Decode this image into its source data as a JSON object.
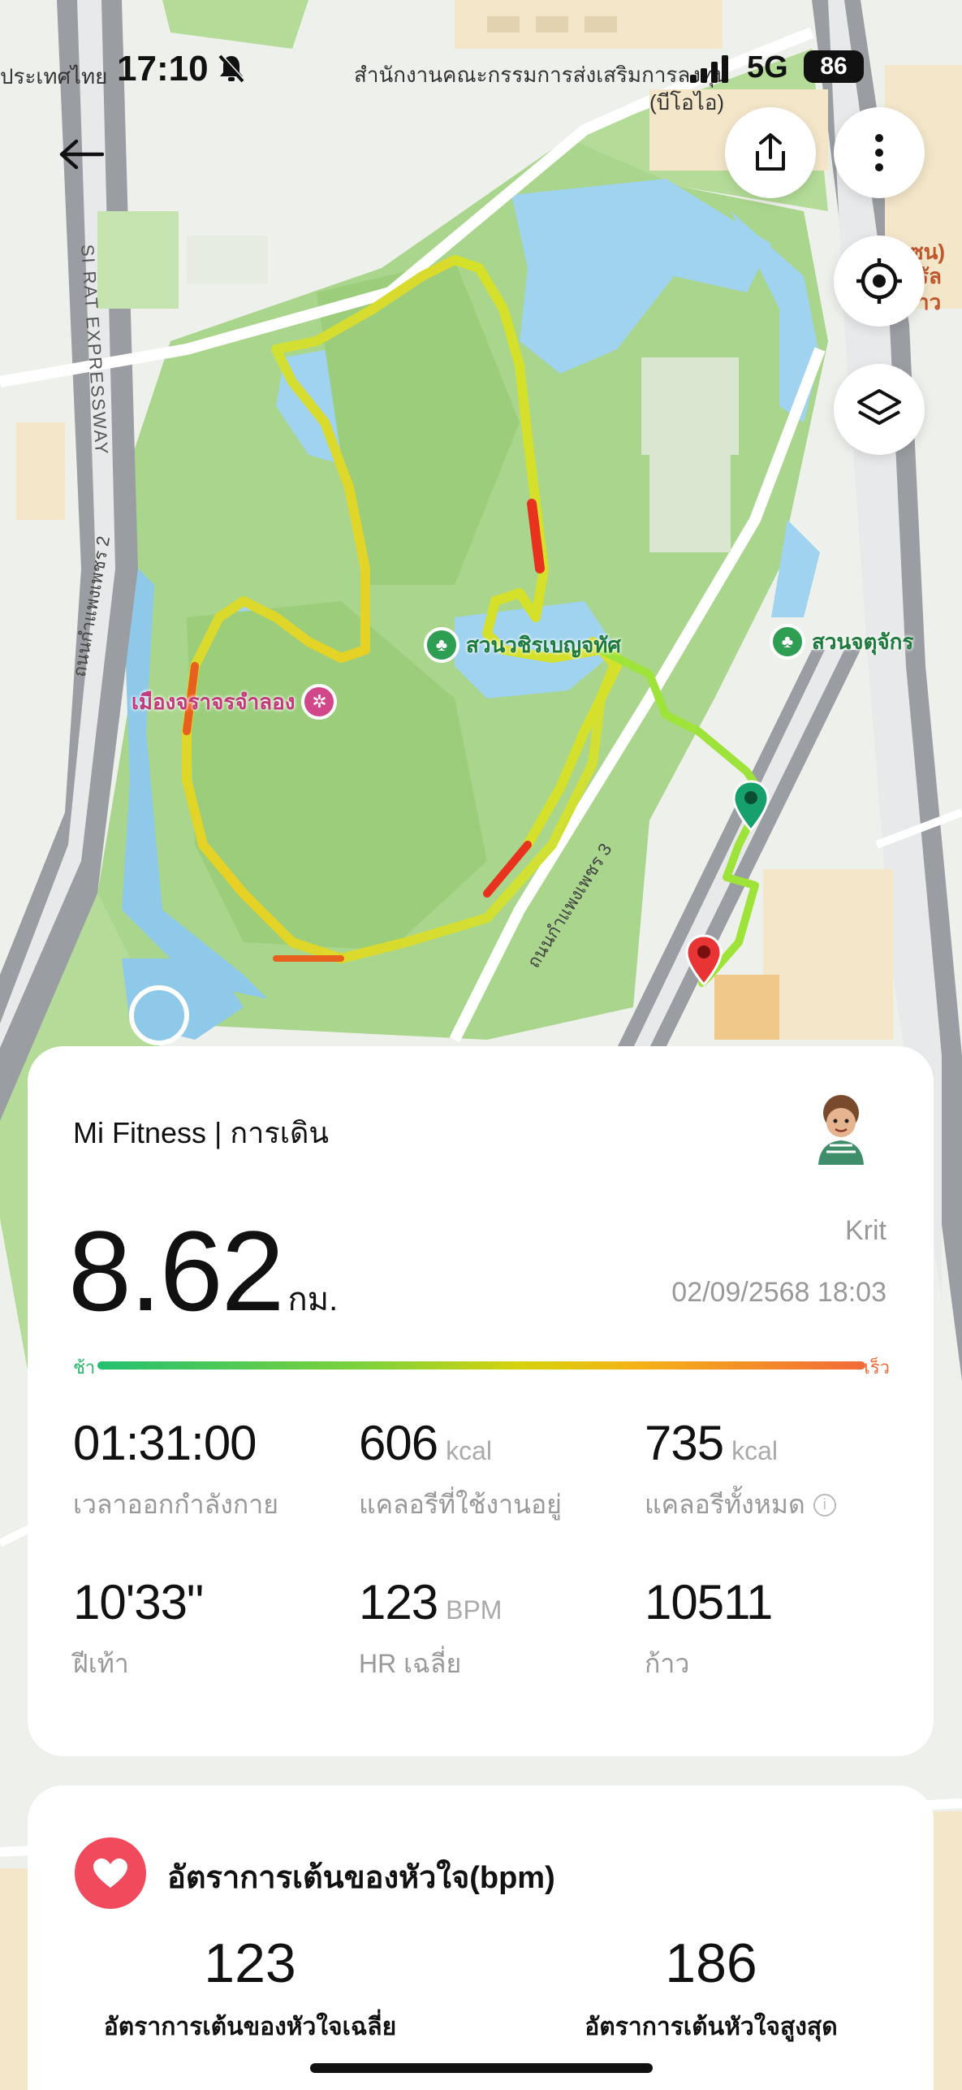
{
  "status_bar": {
    "time": "17:10",
    "network": "5G",
    "battery": "86",
    "map_label_left": "ประเทศไทย",
    "map_label_center": "สำนักงานคณะกรรมการส่งเสริมการลงทุน",
    "map_label_center_sub": "(บีโอไอ)"
  },
  "map": {
    "expressway_label": "SI RAT EXPRESSWAY",
    "road_label_1": "ถนนกำแพงเพชร 2",
    "road_label_2": "ถนนกำแพงเพชร 3",
    "poi_1": "สวนวชิรเบญจทัศ",
    "poi_2": "สวนจตุจักร",
    "poi_3": "เมืองจราจรจำลอง",
    "poi_partial_1": "ซน)",
    "poi_partial_2": "รัล",
    "poi_partial_3": "าว"
  },
  "workout": {
    "app_title": "Mi Fitness | การเดิน",
    "distance": "8.62",
    "distance_unit": "กม.",
    "user_name": "Krit",
    "datetime": "02/09/2568 18:03",
    "speed_slow": "ช้า",
    "speed_fast": "เร็ว",
    "stats": [
      {
        "value": "01:31:00",
        "unit": "",
        "label": "เวลาออกกำลังกาย"
      },
      {
        "value": "606",
        "unit": "kcal",
        "label": "แคลอรีที่ใช้งานอยู่"
      },
      {
        "value": "735",
        "unit": "kcal",
        "label": "แคลอรีทั้งหมด"
      },
      {
        "value": "10'33\"",
        "unit": "",
        "label": "ฝีเท้า"
      },
      {
        "value": "123",
        "unit": "BPM",
        "label": "HR เฉลี่ย"
      },
      {
        "value": "10511",
        "unit": "",
        "label": "ก้าว"
      }
    ]
  },
  "heart_rate": {
    "title": "อัตราการเต้นของหัวใจ(bpm)",
    "avg_value": "123",
    "avg_label": "อัตราการเต้นของหัวใจเฉลี่ย",
    "max_value": "186",
    "max_label": "อัตราการเต้นหัวใจสูงสุด"
  },
  "colors": {
    "route_slow": "#c6e83a",
    "route_fast": "#e8321e",
    "park_green": "#a8d48a",
    "water": "#9fd3ef",
    "heart_accent": "#f04a5c"
  },
  "icons": [
    "back-arrow-icon",
    "share-icon",
    "more-icon",
    "locate-icon",
    "layers-icon",
    "bell-off-icon",
    "heart-icon",
    "info-icon",
    "tree-icon",
    "ferris-wheel-icon",
    "start-pin-icon",
    "end-pin-icon"
  ]
}
